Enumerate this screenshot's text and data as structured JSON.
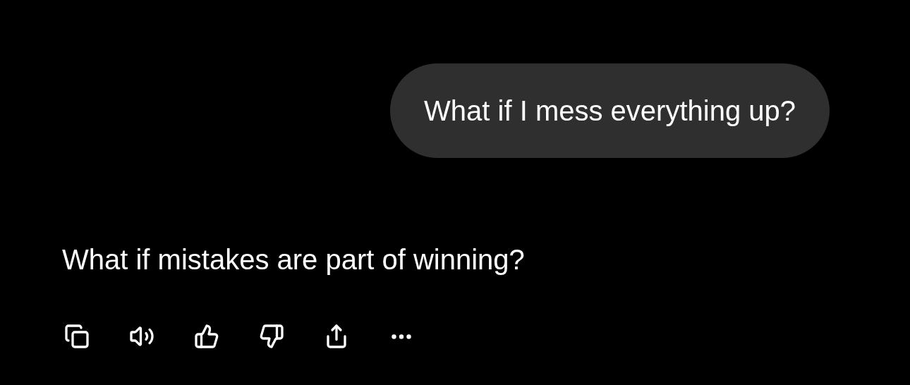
{
  "user_message": {
    "text": "What if I mess everything up?"
  },
  "assistant_message": {
    "text": "What if mistakes are part of winning?"
  },
  "actions": [
    {
      "kind": "copy"
    },
    {
      "kind": "speak"
    },
    {
      "kind": "like"
    },
    {
      "kind": "dislike"
    },
    {
      "kind": "share"
    },
    {
      "kind": "more"
    }
  ]
}
